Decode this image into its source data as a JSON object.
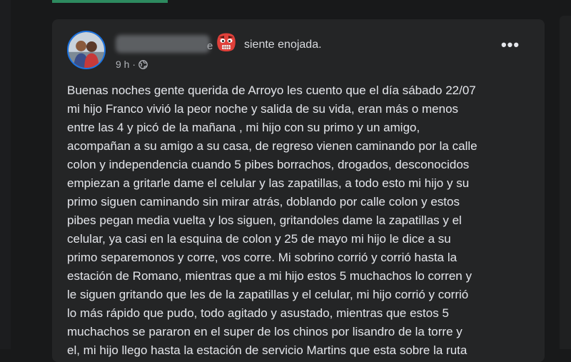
{
  "post": {
    "author_suffix": "e",
    "feeling_emoji": "angry-face-emoji",
    "feeling_text": "siente enojada.",
    "time": "9 h ·",
    "more_label": "•••",
    "lines": [
      "Buenas noches gente querida de Arroyo les cuento que el día sábado 22/07",
      "mi hijo Franco vivió la peor noche y salida de su vida, eran más o menos",
      "entre las 4 y picó de la mañana , mi hijo con su primo y un amigo,",
      "acompañan a su amigo a su casa, de regreso vienen caminando por la calle",
      "colon y independencia cuando 5 pibes borrachos, drogados, desconocidos",
      "empiezan a gritarle dame el celular y las zapatillas, a todo esto mi hijo y su",
      "primo siguen caminando sin mirar atrás, doblando por calle colon y estos",
      "pibes pegan media vuelta y los siguen, gritandoles dame la zapatillas y el",
      "celular, ya casi en la esquina de colon y 25 de mayo mi hijo le dice a su",
      "primo separemonos y corre, vos corre. Mi sobrino corrió y corrió hasta la",
      "estación de Romano, mientras que a mi hijo estos 5 muchachos lo corren y",
      "le siguen gritando que les de la zapatillas y el celular, mi hijo corrió y corrió",
      "lo más rápido que pudo, todo agitado y asustado, mientras que estos 5",
      "muchachos se pararon en el super de los chinos por lisandro de la torre y",
      "el, mi hijo llego hasta la estación de servicio Martins que esta sobre la ruta"
    ]
  },
  "colors": {
    "background": "#18191a",
    "card": "#242526",
    "text": "#e4e6eb",
    "secondary_text": "#b0b3b8",
    "accent": "#2d8a5f",
    "avatar_ring": "#1b74e4"
  }
}
